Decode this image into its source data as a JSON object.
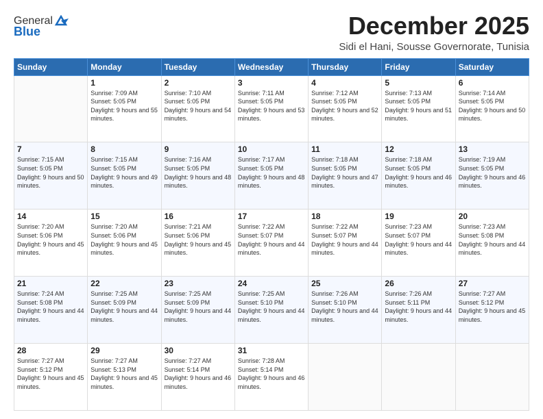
{
  "logo": {
    "general": "General",
    "blue": "Blue"
  },
  "header": {
    "month": "December 2025",
    "location": "Sidi el Hani, Sousse Governorate, Tunisia"
  },
  "weekdays": [
    "Sunday",
    "Monday",
    "Tuesday",
    "Wednesday",
    "Thursday",
    "Friday",
    "Saturday"
  ],
  "weeks": [
    [
      {
        "day": "",
        "sunrise": "",
        "sunset": "",
        "daylight": ""
      },
      {
        "day": "1",
        "sunrise": "Sunrise: 7:09 AM",
        "sunset": "Sunset: 5:05 PM",
        "daylight": "Daylight: 9 hours and 55 minutes."
      },
      {
        "day": "2",
        "sunrise": "Sunrise: 7:10 AM",
        "sunset": "Sunset: 5:05 PM",
        "daylight": "Daylight: 9 hours and 54 minutes."
      },
      {
        "day": "3",
        "sunrise": "Sunrise: 7:11 AM",
        "sunset": "Sunset: 5:05 PM",
        "daylight": "Daylight: 9 hours and 53 minutes."
      },
      {
        "day": "4",
        "sunrise": "Sunrise: 7:12 AM",
        "sunset": "Sunset: 5:05 PM",
        "daylight": "Daylight: 9 hours and 52 minutes."
      },
      {
        "day": "5",
        "sunrise": "Sunrise: 7:13 AM",
        "sunset": "Sunset: 5:05 PM",
        "daylight": "Daylight: 9 hours and 51 minutes."
      },
      {
        "day": "6",
        "sunrise": "Sunrise: 7:14 AM",
        "sunset": "Sunset: 5:05 PM",
        "daylight": "Daylight: 9 hours and 50 minutes."
      }
    ],
    [
      {
        "day": "7",
        "sunrise": "Sunrise: 7:15 AM",
        "sunset": "Sunset: 5:05 PM",
        "daylight": "Daylight: 9 hours and 50 minutes."
      },
      {
        "day": "8",
        "sunrise": "Sunrise: 7:15 AM",
        "sunset": "Sunset: 5:05 PM",
        "daylight": "Daylight: 9 hours and 49 minutes."
      },
      {
        "day": "9",
        "sunrise": "Sunrise: 7:16 AM",
        "sunset": "Sunset: 5:05 PM",
        "daylight": "Daylight: 9 hours and 48 minutes."
      },
      {
        "day": "10",
        "sunrise": "Sunrise: 7:17 AM",
        "sunset": "Sunset: 5:05 PM",
        "daylight": "Daylight: 9 hours and 48 minutes."
      },
      {
        "day": "11",
        "sunrise": "Sunrise: 7:18 AM",
        "sunset": "Sunset: 5:05 PM",
        "daylight": "Daylight: 9 hours and 47 minutes."
      },
      {
        "day": "12",
        "sunrise": "Sunrise: 7:18 AM",
        "sunset": "Sunset: 5:05 PM",
        "daylight": "Daylight: 9 hours and 46 minutes."
      },
      {
        "day": "13",
        "sunrise": "Sunrise: 7:19 AM",
        "sunset": "Sunset: 5:05 PM",
        "daylight": "Daylight: 9 hours and 46 minutes."
      }
    ],
    [
      {
        "day": "14",
        "sunrise": "Sunrise: 7:20 AM",
        "sunset": "Sunset: 5:06 PM",
        "daylight": "Daylight: 9 hours and 45 minutes."
      },
      {
        "day": "15",
        "sunrise": "Sunrise: 7:20 AM",
        "sunset": "Sunset: 5:06 PM",
        "daylight": "Daylight: 9 hours and 45 minutes."
      },
      {
        "day": "16",
        "sunrise": "Sunrise: 7:21 AM",
        "sunset": "Sunset: 5:06 PM",
        "daylight": "Daylight: 9 hours and 45 minutes."
      },
      {
        "day": "17",
        "sunrise": "Sunrise: 7:22 AM",
        "sunset": "Sunset: 5:07 PM",
        "daylight": "Daylight: 9 hours and 44 minutes."
      },
      {
        "day": "18",
        "sunrise": "Sunrise: 7:22 AM",
        "sunset": "Sunset: 5:07 PM",
        "daylight": "Daylight: 9 hours and 44 minutes."
      },
      {
        "day": "19",
        "sunrise": "Sunrise: 7:23 AM",
        "sunset": "Sunset: 5:07 PM",
        "daylight": "Daylight: 9 hours and 44 minutes."
      },
      {
        "day": "20",
        "sunrise": "Sunrise: 7:23 AM",
        "sunset": "Sunset: 5:08 PM",
        "daylight": "Daylight: 9 hours and 44 minutes."
      }
    ],
    [
      {
        "day": "21",
        "sunrise": "Sunrise: 7:24 AM",
        "sunset": "Sunset: 5:08 PM",
        "daylight": "Daylight: 9 hours and 44 minutes."
      },
      {
        "day": "22",
        "sunrise": "Sunrise: 7:25 AM",
        "sunset": "Sunset: 5:09 PM",
        "daylight": "Daylight: 9 hours and 44 minutes."
      },
      {
        "day": "23",
        "sunrise": "Sunrise: 7:25 AM",
        "sunset": "Sunset: 5:09 PM",
        "daylight": "Daylight: 9 hours and 44 minutes."
      },
      {
        "day": "24",
        "sunrise": "Sunrise: 7:25 AM",
        "sunset": "Sunset: 5:10 PM",
        "daylight": "Daylight: 9 hours and 44 minutes."
      },
      {
        "day": "25",
        "sunrise": "Sunrise: 7:26 AM",
        "sunset": "Sunset: 5:10 PM",
        "daylight": "Daylight: 9 hours and 44 minutes."
      },
      {
        "day": "26",
        "sunrise": "Sunrise: 7:26 AM",
        "sunset": "Sunset: 5:11 PM",
        "daylight": "Daylight: 9 hours and 44 minutes."
      },
      {
        "day": "27",
        "sunrise": "Sunrise: 7:27 AM",
        "sunset": "Sunset: 5:12 PM",
        "daylight": "Daylight: 9 hours and 45 minutes."
      }
    ],
    [
      {
        "day": "28",
        "sunrise": "Sunrise: 7:27 AM",
        "sunset": "Sunset: 5:12 PM",
        "daylight": "Daylight: 9 hours and 45 minutes."
      },
      {
        "day": "29",
        "sunrise": "Sunrise: 7:27 AM",
        "sunset": "Sunset: 5:13 PM",
        "daylight": "Daylight: 9 hours and 45 minutes."
      },
      {
        "day": "30",
        "sunrise": "Sunrise: 7:27 AM",
        "sunset": "Sunset: 5:14 PM",
        "daylight": "Daylight: 9 hours and 46 minutes."
      },
      {
        "day": "31",
        "sunrise": "Sunrise: 7:28 AM",
        "sunset": "Sunset: 5:14 PM",
        "daylight": "Daylight: 9 hours and 46 minutes."
      },
      {
        "day": "",
        "sunrise": "",
        "sunset": "",
        "daylight": ""
      },
      {
        "day": "",
        "sunrise": "",
        "sunset": "",
        "daylight": ""
      },
      {
        "day": "",
        "sunrise": "",
        "sunset": "",
        "daylight": ""
      }
    ]
  ]
}
